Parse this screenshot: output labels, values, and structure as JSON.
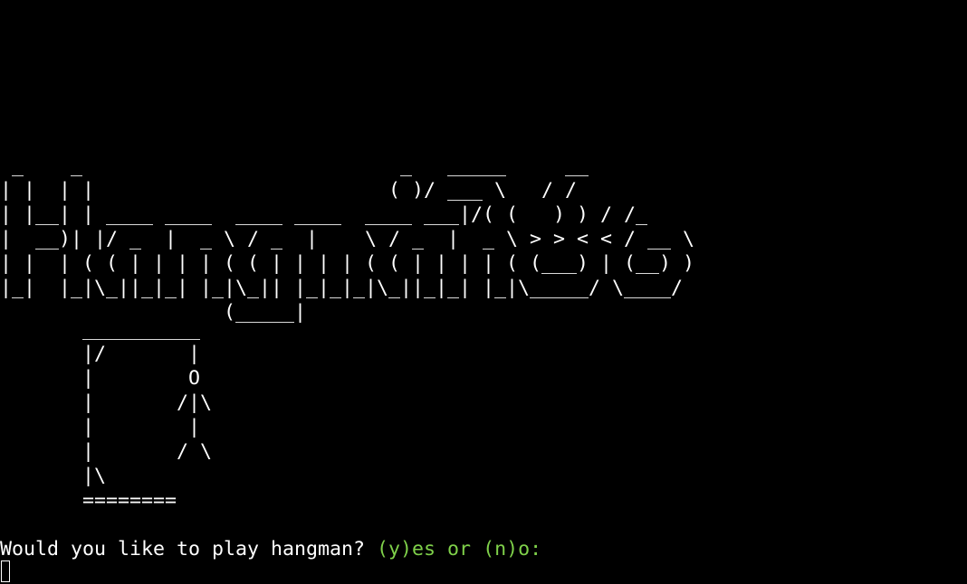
{
  "terminal": {
    "background": "#000000",
    "foreground": "#ffffff",
    "accent": "#7fd14a"
  },
  "title_art": " _    _                           _   _____     __\n| |  | |                         ( )/ ___ \\   / /\n| |__| | ____ ____  ____ ____  ____ ___|/( (   ) ) / /_\n|  __)| |/ _  |  _ \\ / _  |    \\ / _  |  _ \\ > > < < / __ \\\n| |  | ( ( | | | | ( ( | | | | ( ( | | | | ( (___) | (__) )\n|_|  |_|\\_||_|_| |_|\\_|| |_|_|_|\\_||_|_| |_|\\_____/ \\____/\n                   (_____|",
  "gallows_art": "       __________\n       |/       |\n       |        O\n       |       /|\\\n       |        |\n       |       / \\\n       |\\\n       ========",
  "prompt": {
    "question": "Would you like to play hangman? ",
    "yes_option": "(y)es",
    "separator": " or ",
    "no_option": "(n)o:"
  }
}
